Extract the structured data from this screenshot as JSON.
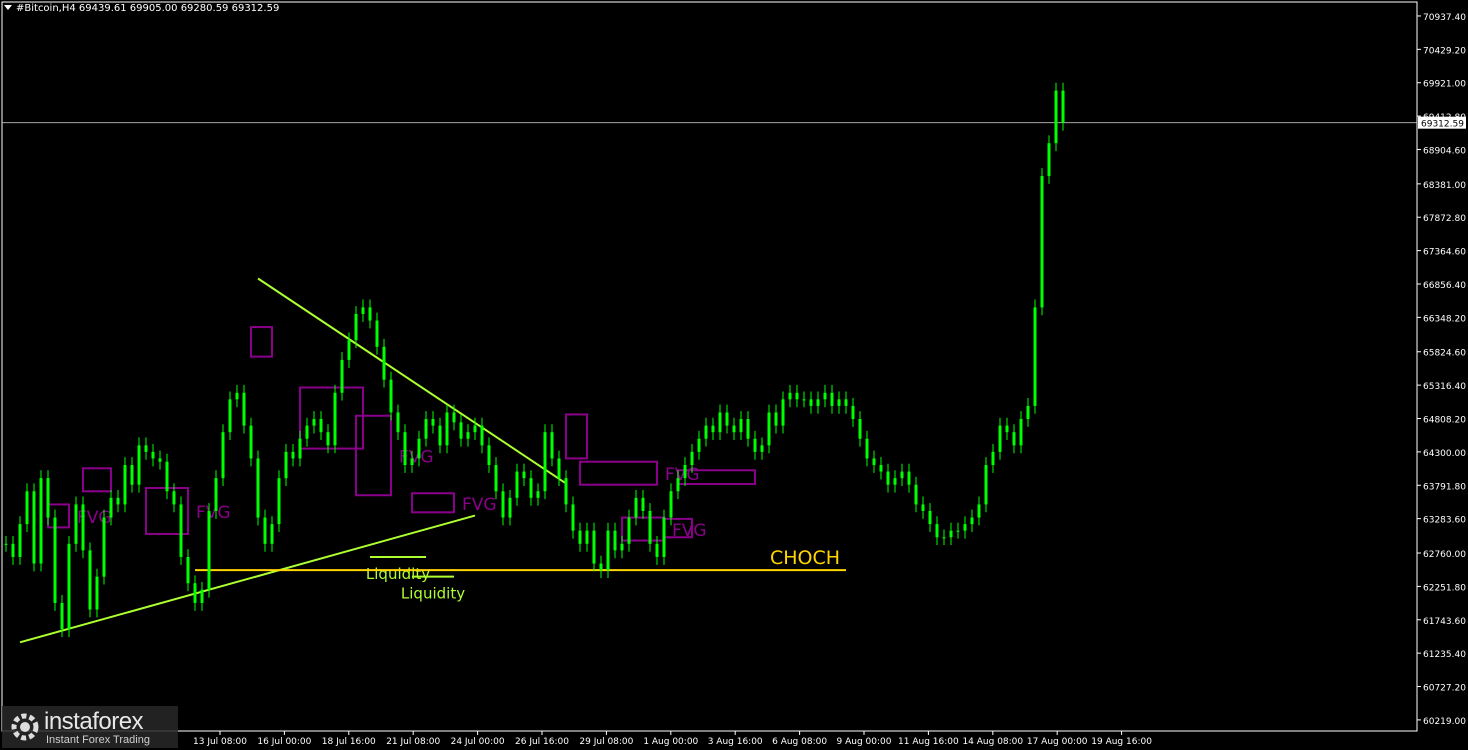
{
  "header": {
    "title": "#Bitcoin,H4  69439.61 69905.00 69280.59 69312.59"
  },
  "logo": {
    "brand": "instaforex",
    "tagline": "Instant Forex Trading",
    "icon": "instaforex-logo-icon"
  },
  "colors": {
    "background": "#000000",
    "candle": "#00ff00",
    "trendline": "#adff2f",
    "fvg_box": "#8b008b",
    "choch_line": "#ffd700",
    "axis": "#ffffff"
  },
  "chart_data": {
    "type": "line",
    "title": "",
    "xlabel": "",
    "ylabel": "",
    "ylim": [
      60000,
      71200
    ],
    "grid": false,
    "current_price": "69312.59",
    "y_ticks": [
      "70937.40",
      "70429.20",
      "69921.00",
      "69412.80",
      "68904.60",
      "68381.00",
      "67872.80",
      "67364.60",
      "66856.40",
      "66348.20",
      "65824.60",
      "65316.40",
      "64808.20",
      "64300.00",
      "63791.80",
      "63283.60",
      "62760.00",
      "62251.80",
      "61743.60",
      "61235.40",
      "60727.20",
      "60219.00"
    ],
    "x_ticks": [
      "13 Jul 08:00",
      "16 Jul 00:00",
      "18 Jul 16:00",
      "21 Jul 08:00",
      "24 Jul 00:00",
      "26 Jul 16:00",
      "29 Jul 08:00",
      "1 Aug 00:00",
      "3 Aug 16:00",
      "6 Aug 08:00",
      "9 Aug 00:00",
      "11 Aug 16:00",
      "14 Aug 08:00",
      "17 Aug 00:00",
      "19 Aug 16:00"
    ],
    "series": [
      {
        "values": [
          62900,
          62700,
          63200,
          63700,
          62600,
          63900,
          63300,
          62000,
          61600,
          62900,
          63500,
          62800,
          61900,
          62400,
          63300,
          63600,
          63500,
          64100,
          63800,
          64400,
          64300,
          64200,
          64150,
          63700,
          63500,
          62700,
          62300,
          62000,
          62200,
          63400,
          63900,
          64600,
          65100,
          65200,
          64700,
          64200,
          63300,
          62900,
          63200,
          63900,
          64300,
          64200,
          64500,
          64700,
          64800,
          64600,
          64400,
          65200,
          65700,
          66000,
          66400,
          66500,
          66300,
          65900,
          65400,
          64900,
          64600,
          64100,
          64200,
          64500,
          64800,
          64700,
          64400,
          64900,
          64750,
          64500,
          64600,
          64700,
          64400,
          64100,
          63700,
          63300,
          63600,
          64000,
          63900,
          63600,
          63700,
          64600,
          64200,
          63900,
          63500,
          63100,
          62900,
          63100,
          62600,
          62500,
          63100,
          62800,
          62900,
          63300,
          63600,
          63400,
          62900,
          62700,
          63300,
          63700,
          63900,
          64100,
          64300,
          64500,
          64700,
          64600,
          64900,
          64700,
          64600,
          64800,
          64500,
          64300,
          64400,
          64900,
          64700,
          65100,
          65200,
          65100,
          65100,
          65000,
          65100,
          65200,
          65000,
          65100,
          65000,
          64800,
          64500,
          64200,
          64100,
          64000,
          63800,
          63900,
          64000,
          63800,
          63500,
          63400,
          63200,
          63000,
          63000,
          63100,
          63100,
          63200,
          63300,
          63500,
          64100,
          64300,
          64700,
          64600,
          64400,
          64800,
          65000,
          66500,
          68500,
          69000,
          69800,
          69312
        ]
      }
    ],
    "annotations": [
      {
        "type": "box",
        "label": "FVG",
        "x0_index": 6,
        "x1_index": 9,
        "y_low": 63150,
        "y_high": 63500
      },
      {
        "type": "box",
        "label": "",
        "x0_index": 11,
        "x1_index": 15,
        "y_low": 63700,
        "y_high": 64050
      },
      {
        "type": "box",
        "label": "FVG",
        "x0_index": 20,
        "x1_index": 26,
        "y_low": 63050,
        "y_high": 63750
      },
      {
        "type": "box",
        "label": "",
        "x0_index": 35,
        "x1_index": 38,
        "y_low": 65750,
        "y_high": 66200
      },
      {
        "type": "box",
        "label": "",
        "x0_index": 42,
        "x1_index": 51,
        "y_low": 64350,
        "y_high": 65280
      },
      {
        "type": "box",
        "label": "FVG",
        "x0_index": 50,
        "x1_index": 55,
        "y_low": 63640,
        "y_high": 64850
      },
      {
        "type": "box",
        "label": "FVG",
        "x0_index": 58,
        "x1_index": 64,
        "y_low": 63380,
        "y_high": 63670
      },
      {
        "type": "box",
        "label": "",
        "x0_index": 80,
        "x1_index": 83,
        "y_low": 64200,
        "y_high": 64870
      },
      {
        "type": "box",
        "label": "FVG",
        "x0_index": 82,
        "x1_index": 93,
        "y_low": 63800,
        "y_high": 64150
      },
      {
        "type": "box",
        "label": "FVG",
        "x0_index": 88,
        "x1_index": 94,
        "y_low": 62950,
        "y_high": 63300
      },
      {
        "type": "box",
        "label": "",
        "x0_index": 94,
        "x1_index": 98,
        "y_low": 63000,
        "y_high": 63280
      },
      {
        "type": "box",
        "label": "",
        "x0_index": 96,
        "x1_index": 107,
        "y_low": 63810,
        "y_high": 64020
      },
      {
        "type": "trendline",
        "from": [
          2,
          61400
        ],
        "to": [
          67,
          63330
        ]
      },
      {
        "type": "trendline",
        "from": [
          36,
          66940
        ],
        "to": [
          80,
          63820
        ]
      },
      {
        "type": "level",
        "label": "Liquidity",
        "x0_index": 52,
        "x1_index": 60,
        "y": 62700
      },
      {
        "type": "level",
        "label": "Liquidity",
        "x0_index": 58,
        "x1_index": 64,
        "y": 62400
      },
      {
        "type": "level",
        "label": "CHOCH",
        "x0_index": 27,
        "x1_index": 120,
        "y": 62500
      }
    ]
  }
}
